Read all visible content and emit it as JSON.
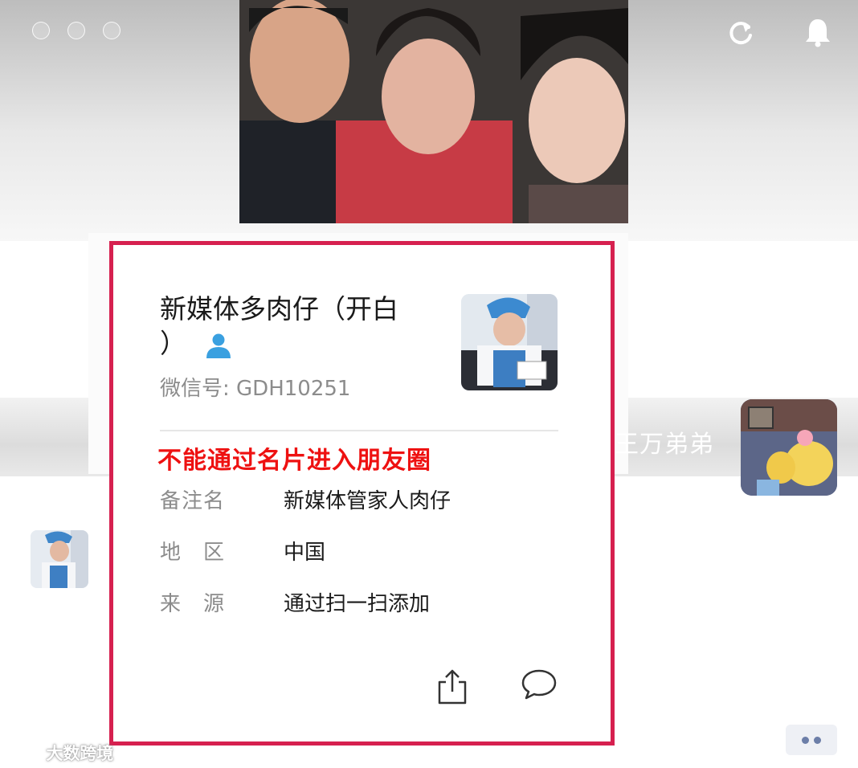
{
  "header": {
    "refresh_icon": "refresh-icon",
    "bell_icon": "bell-icon"
  },
  "background": {
    "right_contact_name": "王万弟弟"
  },
  "card": {
    "title": "新媒体多肉仔（开白）",
    "title_line1": "新媒体多肉仔（开白",
    "title_line2": "）",
    "wechat_id_label": "微信号: ",
    "wechat_id": "GDH10251",
    "warning": "不能通过名片进入朋友圈",
    "rows": [
      {
        "label": "备注名",
        "value": "新媒体管家人肉仔"
      },
      {
        "label": "地　区",
        "value": "中国"
      },
      {
        "label": "来　源",
        "value": "通过扫一扫添加"
      }
    ],
    "border_color": "#d6204f",
    "warning_color": "#ee1111",
    "person_icon": "person-icon",
    "share_icon": "share-icon",
    "chat_icon": "chat-bubble-icon"
  },
  "watermark": {
    "text": "大数跨境"
  }
}
